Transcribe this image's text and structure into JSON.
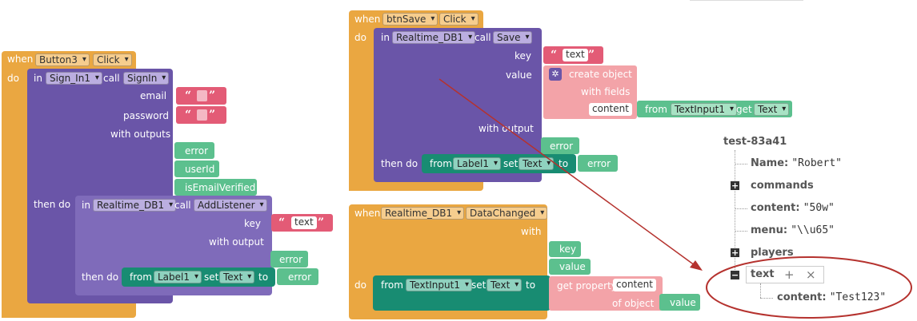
{
  "block1": {
    "when": "when",
    "do": "do",
    "component": "Button3",
    "event": "Click",
    "in": "in",
    "call": "call",
    "target": "Sign_In1",
    "method": "SignIn",
    "email": "email",
    "password": "password",
    "with_outputs": "with outputs",
    "outputs": [
      "error",
      "userId",
      "isEmailVerified"
    ],
    "then_do": "then do",
    "inner": {
      "in": "in",
      "target": "Realtime_DB1",
      "call": "call",
      "method": "AddListener",
      "key": "key",
      "key_value": "text",
      "with_output": "with output",
      "output": "error",
      "then_do": "then do",
      "from": "from",
      "comp": "Label1",
      "set": "set",
      "prop": "Text",
      "to": "to",
      "value": "error"
    }
  },
  "block2": {
    "when": "when",
    "do": "do",
    "component": "btnSave",
    "event": "Click",
    "in": "in",
    "target": "Realtime_DB1",
    "call": "call",
    "method": "Save",
    "key": "key",
    "key_value": "text",
    "value": "value",
    "create_object": "create object",
    "with_fields": "with fields",
    "field": "content",
    "from": "from",
    "src_comp": "TextInput1",
    "get": "get",
    "src_prop": "Text",
    "with_output": "with output",
    "output": "error",
    "then_do": "then do",
    "set_from": "from",
    "set_comp": "Label1",
    "set": "set",
    "set_prop": "Text",
    "to": "to",
    "set_value": "error"
  },
  "block3": {
    "when": "when",
    "component": "Realtime_DB1",
    "event": "DataChanged",
    "with": "with",
    "params": [
      "key",
      "value"
    ],
    "do": "do",
    "from": "from",
    "comp": "TextInput1",
    "set": "set",
    "prop": "Text",
    "to": "to",
    "get_property": "get property",
    "property": "content",
    "of_object": "of object",
    "object_value": "value"
  },
  "database": {
    "root": "test-83a41",
    "nodes": [
      {
        "key": "Name:",
        "value": "\"Robert\""
      },
      {
        "key": "commands",
        "value": ""
      },
      {
        "key": "content:",
        "value": "\"50w\""
      },
      {
        "key": "menu:",
        "value": "\"\\\\u65\""
      },
      {
        "key": "players",
        "value": ""
      }
    ],
    "text_node": {
      "key": "text",
      "add": "+",
      "remove": "×"
    },
    "child": {
      "key": "content:",
      "value": "\"Test123\""
    }
  },
  "colors": {
    "event": "#eaa741",
    "procedure": "#6a55a8",
    "text": "#e35b76",
    "output": "#5cc08e",
    "setter": "#188c72",
    "dictionary": "#f3a3a8",
    "annotation": "#b5322e"
  },
  "icons": [
    "gear-icon",
    "plus-square-icon",
    "minus-square-icon",
    "add-icon",
    "close-icon"
  ]
}
